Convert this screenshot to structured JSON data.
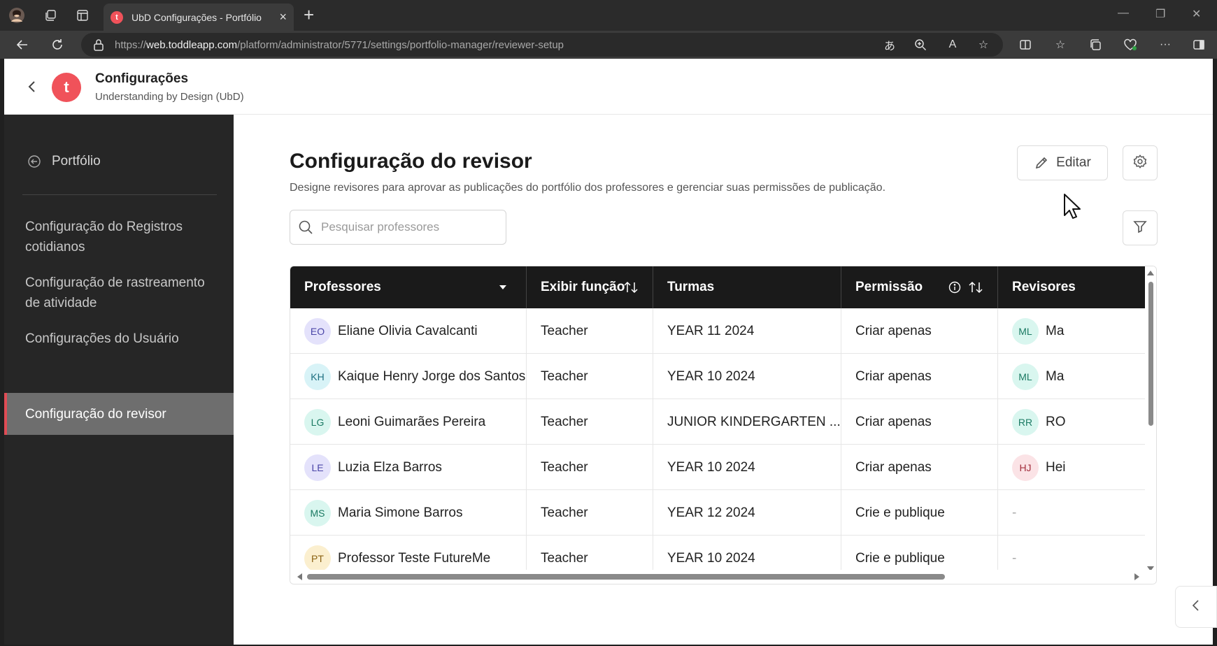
{
  "browser": {
    "tab_title": "UbD Configurações - Portfólio",
    "favicon_letter": "t",
    "url_prefix": "https://",
    "url_host": "web.toddleapp.com",
    "url_path": "/platform/administrator/5771/settings/portfolio-manager/reviewer-setup"
  },
  "header": {
    "logo_letter": "t",
    "title": "Configurações",
    "subtitle": "Understanding by Design (UbD)"
  },
  "sidebar": {
    "back_label": "Portfólio",
    "items": [
      {
        "label": "Configuração do Registros cotidianos"
      },
      {
        "label": "Configuração de rastreamento de atividade"
      },
      {
        "label": "Configurações do Usuário"
      },
      {
        "label": "Configuração do revisor"
      }
    ]
  },
  "main": {
    "title": "Configuração do revisor",
    "description": "Designe revisores para aprovar as publicações do portfólio dos professores e gerenciar suas permissões de publicação.",
    "edit_label": "Editar",
    "search_placeholder": "Pesquisar professores"
  },
  "table": {
    "columns": [
      "Professores",
      "Exibir função",
      "Turmas",
      "Permissão",
      "Revisores"
    ],
    "rows": [
      {
        "initials": "EO",
        "name": "Eliane Olivia Cavalcanti",
        "role": "Teacher",
        "class": "YEAR 11 2024",
        "permission": "Criar apenas",
        "rev_initials": "ML",
        "rev_name": "Ma",
        "av_bg": "#e4e2fb",
        "av_fg": "#4b46a8",
        "rv_bg": "#d9f6ef",
        "rv_fg": "#1b7a63"
      },
      {
        "initials": "KH",
        "name": "Kaique Henry Jorge dos Santos",
        "role": "Teacher",
        "class": "YEAR 10 2024",
        "permission": "Criar apenas",
        "rev_initials": "ML",
        "rev_name": "Ma",
        "av_bg": "#d8f3f7",
        "av_fg": "#1d6f80",
        "rv_bg": "#d9f6ef",
        "rv_fg": "#1b7a63"
      },
      {
        "initials": "LG",
        "name": "Leoni Guimarães Pereira",
        "role": "Teacher",
        "class": "JUNIOR KINDERGARTEN ...",
        "permission": "Criar apenas",
        "rev_initials": "RR",
        "rev_name": "RO",
        "av_bg": "#d9f6ef",
        "av_fg": "#1b7a63",
        "rv_bg": "#d9f6ef",
        "rv_fg": "#1b7a63"
      },
      {
        "initials": "LE",
        "name": "Luzia Elza Barros",
        "role": "Teacher",
        "class": "YEAR 10 2024",
        "permission": "Criar apenas",
        "rev_initials": "HJ",
        "rev_name": "Hei",
        "av_bg": "#e4e2fb",
        "av_fg": "#4b46a8",
        "rv_bg": "#fbe3e6",
        "rv_fg": "#a3303f"
      },
      {
        "initials": "MS",
        "name": "Maria Simone Barros",
        "role": "Teacher",
        "class": "YEAR 12 2024",
        "permission": "Crie e publique",
        "rev_initials": "",
        "rev_name": "-",
        "av_bg": "#d9f6ef",
        "av_fg": "#1b7a63",
        "rv_bg": "",
        "rv_fg": ""
      },
      {
        "initials": "PT",
        "name": "Professor Teste FutureMe",
        "role": "Teacher",
        "class": "YEAR 10 2024",
        "permission": "Crie e publique",
        "rev_initials": "",
        "rev_name": "-",
        "av_bg": "#fbefcf",
        "av_fg": "#8a6112",
        "rv_bg": "",
        "rv_fg": ""
      }
    ]
  },
  "icons": [
    "avatar-icon",
    "workspaces-icon",
    "tab-actions-icon",
    "close-icon",
    "plus-icon",
    "back-arrow-icon",
    "refresh-icon",
    "lock-icon",
    "translate-icon",
    "zoom-icon",
    "read-aloud-icon",
    "star-icon",
    "split-screen-icon",
    "favorites-icon",
    "collections-icon",
    "health-icon",
    "more-icon",
    "sidebar-icon",
    "chevron-left-icon",
    "pencil-icon",
    "gear-icon",
    "search-icon",
    "filter-icon",
    "info-icon",
    "sort-icon",
    "caret-down-icon"
  ],
  "colors": {
    "brand": "#f0525a",
    "active_accent": "#e04c55",
    "header_bg": "#1a1a1a",
    "sidebar_bg": "#262626"
  }
}
